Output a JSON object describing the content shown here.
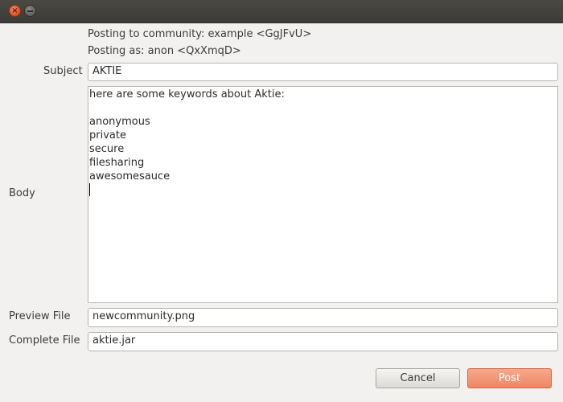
{
  "titlebar": {
    "close_icon": "close-icon",
    "minimize_icon": "minimize-icon"
  },
  "header": {
    "community_line": "Posting to community: example <GgJFvU>",
    "identity_line": "Posting as: anon <QxXmqD>"
  },
  "form": {
    "subject_label": "Subject",
    "subject_value": "AKTIE",
    "body_label": "Body",
    "body_lines": [
      "here are some keywords about Aktie:",
      "",
      "anonymous",
      "private",
      "secure",
      "filesharing",
      "awesomesauce",
      ""
    ],
    "preview_label": "Preview File",
    "preview_value": "newcommunity.png",
    "complete_label": "Complete File",
    "complete_value": "aktie.jar"
  },
  "actions": {
    "cancel_label": "Cancel",
    "post_label": "Post"
  },
  "colors": {
    "post_button": "#ee8764",
    "titlebar": "#3c3b37",
    "window_bg": "#f2f1f0"
  }
}
